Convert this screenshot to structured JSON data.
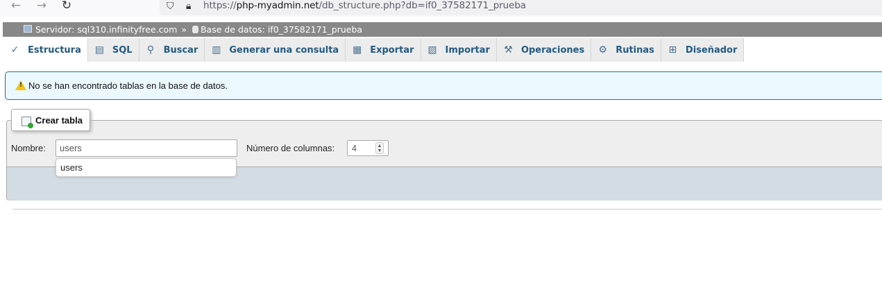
{
  "browser": {
    "back_glyph": "←",
    "forward_glyph": "→",
    "reload_glyph": "↻",
    "url_scheme": "https://",
    "url_host": "php-myadmin.net",
    "url_path": "/db_structure.php?db=if0_37582171_prueba"
  },
  "breadcrumb": {
    "server_label": "Servidor: sql310.infinityfree.com",
    "separator": "»",
    "database_label": "Base de datos: if0_37582171_prueba"
  },
  "tabs": [
    {
      "label": "Estructura",
      "icon": "structure-icon",
      "glyph": "✓",
      "active": true
    },
    {
      "label": "SQL",
      "icon": "sql-icon",
      "glyph": "▤",
      "active": false
    },
    {
      "label": "Buscar",
      "icon": "search-icon",
      "glyph": "⚲",
      "active": false
    },
    {
      "label": "Generar una consulta",
      "icon": "query-icon",
      "glyph": "▥",
      "active": false
    },
    {
      "label": "Exportar",
      "icon": "export-icon",
      "glyph": "▦",
      "active": false
    },
    {
      "label": "Importar",
      "icon": "import-icon",
      "glyph": "▧",
      "active": false
    },
    {
      "label": "Operaciones",
      "icon": "wrench-icon",
      "glyph": "⚒",
      "active": false
    },
    {
      "label": "Rutinas",
      "icon": "routines-icon",
      "glyph": "⚙",
      "active": false
    },
    {
      "label": "Diseñador",
      "icon": "designer-icon",
      "glyph": "⊞",
      "active": false
    }
  ],
  "notice": {
    "text": "No se han encontrado tablas en la base de datos."
  },
  "create_table": {
    "legend": "Crear tabla",
    "name_label": "Nombre:",
    "name_value": "users",
    "columns_label": "Número de columnas:",
    "columns_value": "4",
    "spinner_up": "▲",
    "spinner_down": "▼",
    "autocomplete_suggestion": "users"
  },
  "colors": {
    "tab_text": "#235a81",
    "server_bar": "#888888",
    "notice_bg": "#ebf8fd",
    "notice_border": "#2a6c8f",
    "footer_bg": "#d3dce3"
  }
}
